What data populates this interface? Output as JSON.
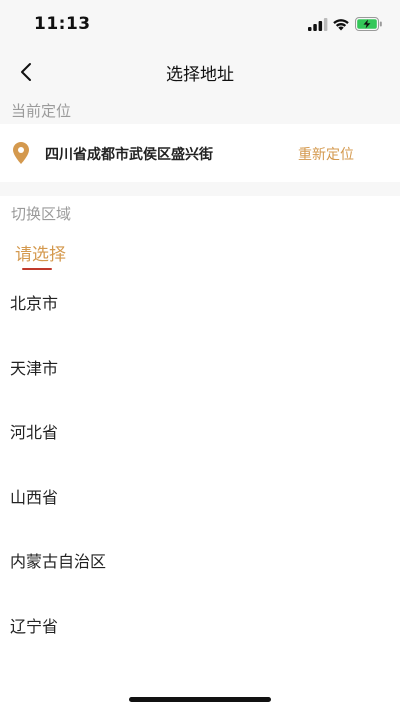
{
  "status_bar": {
    "time": "11:13"
  },
  "nav": {
    "title": "选择地址"
  },
  "current_location": {
    "section_label": "当前定位",
    "address": "四川省成都市武侯区盛兴街",
    "relocate_label": "重新定位"
  },
  "switch_region": {
    "section_label": "切换区域",
    "active_tab": "请选择"
  },
  "provinces": [
    "北京市",
    "天津市",
    "河北省",
    "山西省",
    "内蒙古自治区",
    "辽宁省"
  ],
  "colors": {
    "accent": "#d4994e",
    "tab_underline": "#c0392b",
    "battery_charging": "#34c759"
  },
  "icons": {
    "back": "chevron-left-icon",
    "location": "location-pin-icon",
    "signal": "cellular-signal-icon",
    "wifi": "wifi-icon",
    "battery": "battery-charging-icon"
  }
}
